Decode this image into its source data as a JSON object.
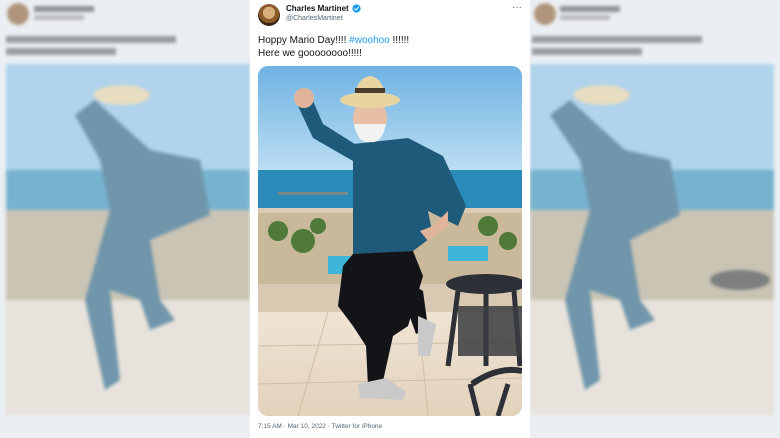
{
  "tweet": {
    "author_name": "Charles Martinet",
    "author_handle": "@CharlesMartinet",
    "text_line1_prefix": "Hoppy Mario Day!!!! ",
    "hashtag": "#woohoo",
    "text_line1_suffix": " !!!!!!",
    "text_line2": "Here we goooooooo!!!!!",
    "timestamp": "7:15 AM · Mar 10, 2022 · Twitter for iPhone"
  },
  "icons": {
    "verified": "verified-badge-icon",
    "more": "more-options-icon"
  },
  "colors": {
    "hashtag": "#1d9bf0",
    "verified": "#1d9bf0",
    "shirt": "#1f5a7a",
    "sky": "#8cc3e8",
    "sea": "#2a8bb8"
  }
}
